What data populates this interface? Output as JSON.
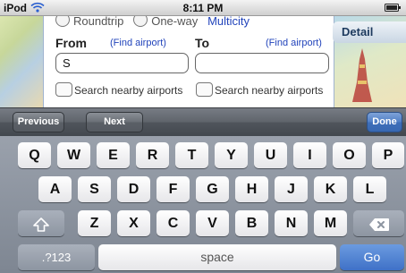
{
  "status_bar": {
    "carrier": "iPod",
    "time": "8:11 PM",
    "wifi_icon": "wifi-icon",
    "battery_icon": "battery-icon"
  },
  "form": {
    "trip_options": [
      "Roundtrip",
      "One-way",
      "Multicity"
    ],
    "from_label": "From",
    "from_find_link": "(Find airport)",
    "from_value": "S",
    "to_label": "To",
    "to_find_link": "(Find airport)",
    "to_value": "",
    "nearby_from": "Search nearby airports",
    "nearby_to": "Search nearby airports",
    "details_tab": "Detail"
  },
  "form_bar": {
    "previous_label": "Previous",
    "next_label": "Next",
    "done_label": "Done"
  },
  "keyboard": {
    "row1": [
      "Q",
      "W",
      "E",
      "R",
      "T",
      "Y",
      "U",
      "I",
      "O",
      "P"
    ],
    "row2": [
      "A",
      "S",
      "D",
      "F",
      "G",
      "H",
      "J",
      "K",
      "L"
    ],
    "row3": [
      "Z",
      "X",
      "C",
      "V",
      "B",
      "N",
      "M"
    ],
    "shift_icon": "shift-icon",
    "backspace_icon": "backspace-icon",
    "numbers_label": ".?123",
    "space_label": "space",
    "go_label": "Go"
  },
  "colors": {
    "link": "#2244bb",
    "done_button": "#3f6fb9",
    "go_key": "#3f71c7"
  }
}
